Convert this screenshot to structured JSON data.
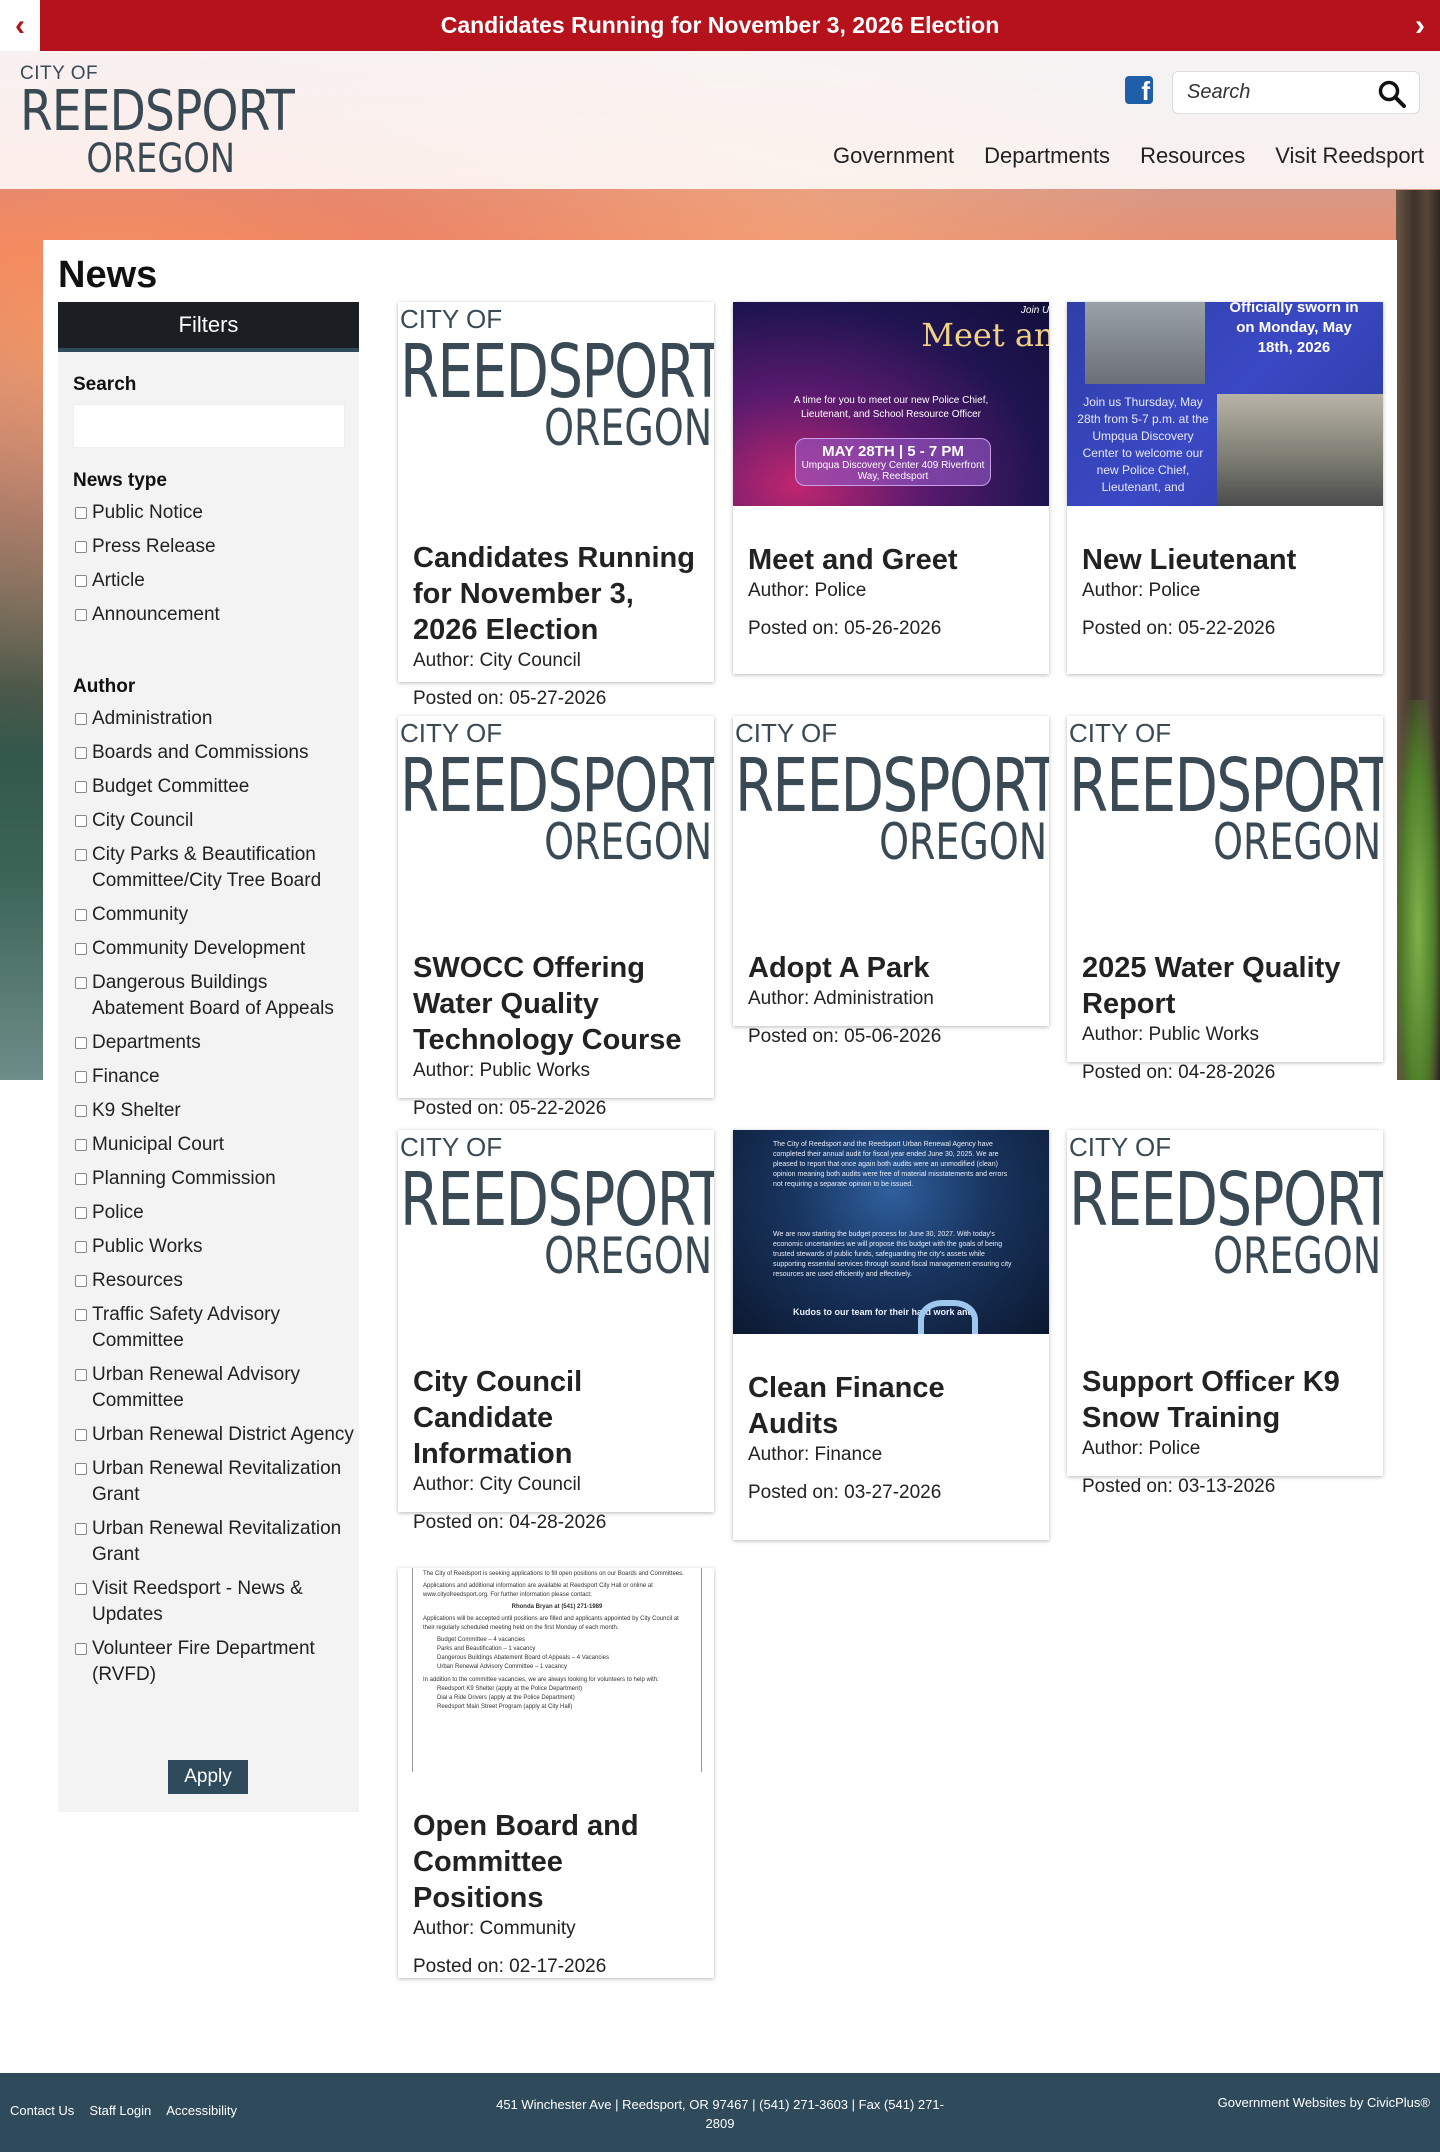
{
  "alert": {
    "text": "Candidates Running for November 3, 2026 Election",
    "prev_icon": "chevron-left-icon",
    "next_icon": "chevron-right-icon"
  },
  "header": {
    "logo": {
      "city_of": "CITY OF",
      "main": "REEDSPORT",
      "sub": "OREGON"
    },
    "facebook_icon": "facebook-icon",
    "search_placeholder": "Search",
    "nav": [
      "Government",
      "Departments",
      "Resources",
      "Visit Reedsport"
    ]
  },
  "page": {
    "title": "News"
  },
  "filters": {
    "header": "Filters",
    "search_label": "Search",
    "search_value": "",
    "news_type_label": "News type",
    "news_types": [
      "Public Notice",
      "Press Release",
      "Article",
      "Announcement"
    ],
    "author_label": "Author",
    "authors": [
      "Administration",
      "Boards and Commissions",
      "Budget Committee",
      "City Council",
      "City Parks & Beautification Committee/City Tree Board",
      "Community",
      "Community Development",
      "Dangerous Buildings Abatement Board of Appeals",
      "Departments",
      "Finance",
      "K9 Shelter",
      "Municipal Court",
      "Planning Commission",
      "Police",
      "Public Works",
      "Resources",
      "Traffic Safety Advisory Committee",
      "Urban Renewal Advisory Committee",
      "Urban Renewal District Agency",
      "Urban Renewal Revitalization Grant",
      "Urban Renewal Revitalization Grant",
      "Visit Reedsport - News & Updates",
      "Volunteer Fire Department (RVFD)"
    ],
    "apply_label": "Apply"
  },
  "cards": [
    {
      "title": "Candidates Running for November 3, 2026 Election",
      "author": "Author: City Council",
      "posted": "Posted on: 05-27-2026"
    },
    {
      "title": "Meet and Greet",
      "author": "Author: Police",
      "posted": "Posted on: 05-26-2026"
    },
    {
      "title": "New Lieutenant",
      "author": "Author: Police",
      "posted": "Posted on: 05-22-2026"
    },
    {
      "title": "SWOCC Offering Water Quality Technology Course",
      "author": "Author: Public Works",
      "posted": "Posted on: 05-22-2026"
    },
    {
      "title": "Adopt A Park",
      "author": "Author: Administration",
      "posted": "Posted on: 05-06-2026"
    },
    {
      "title": "2025 Water Quality Report",
      "author": "Author: Public Works",
      "posted": "Posted on: 04-28-2026"
    },
    {
      "title": "City Council Candidate Information",
      "author": "Author: City Council",
      "posted": "Posted on: 04-28-2026"
    },
    {
      "title": "Clean Finance Audits",
      "author": "Author: Finance",
      "posted": "Posted on: 03-27-2026"
    },
    {
      "title": "Support Officer K9 Snow Training",
      "author": "Author: Police",
      "posted": "Posted on: 03-13-2026"
    },
    {
      "title": "Open Board and Committee Positions",
      "author": "Author: Community",
      "posted": "Posted on: 02-17-2026"
    }
  ],
  "thumbs": {
    "logo": {
      "city_of": "CITY OF",
      "main": "REEDSPORT",
      "sub": "OREGON"
    },
    "meet": {
      "small": "Join Us for a",
      "big": "Meet and Greet",
      "mid": "A time for you to meet our new Police Chief, Lieutenant, and School Resource Officer",
      "pill": "MAY 28TH | 5 - 7 PM",
      "pill_sub": "Umpqua Discovery Center 409 Riverfront Way, Reedsport"
    },
    "lieut": {
      "top": "Officially sworn in on Monday, May 18th, 2026",
      "text": "Join us Thursday, May 28th from 5-7 p.m. at the Umpqua Discovery Center to welcome our new Police Chief, Lieutenant, and"
    },
    "finance": {
      "text1": "The City of Reedsport and the Reedsport Urban Renewal Agency have completed their annual audit for fiscal year ended June 30, 2025. We are pleased to report that once again both audits were an unmodified (clean) opinion meaning both audits were free of material misstatements and errors not requiring a separate opinion to be issued.",
      "text2": "We are now starting the budget process for June 30, 2027. With today's economic uncertainties we will propose this budget with the goals of being trusted stewards of public funds, safeguarding the city's assets while supporting essential services through sound fiscal management ensuring city resources are used efficiently and effectively.",
      "bottom": "Kudos to our team for their hard work and"
    },
    "doc": {
      "p1": "The City of Reedsport is seeking applications to fill open positions on our Boards and Committees.",
      "p2": "Applications and additional information are available at Reedsport City Hall or online at www.cityofreedsport.org. For further information please contact:",
      "contact": "Rhonda Bryan at (541) 271-1989",
      "p3": "Applications will be accepted until positions are filled and applicants appointed by City Council at their regularly scheduled meeting held on the first Monday of each month.",
      "list": [
        "Budget Committee – 4 vacancies",
        "Parks and Beautification – 1 vacancy",
        "Dangerous Buildings Abatement Board of Appeals – 4 Vacancies",
        "Urban Renewal Advisory Committee – 1 vacancy"
      ],
      "p4": "In addition to the committee vacancies, we are always looking for volunteers to help with:",
      "list2": [
        "Reedsport K9 Shelter (apply at the Police Department)",
        "Dial a Ride Drivers (apply at the Police Department)",
        "Reedsport Main Street Program (apply at City Hall)"
      ]
    }
  },
  "footer": {
    "links": [
      "Contact Us",
      "Staff Login",
      "Accessibility"
    ],
    "address": "451 Winchester Ave | Reedsport, OR 97467 | (541) 271-3603 | Fax (541) 271-2809",
    "credit": "Government Websites by CivicPlus®"
  },
  "colors": {
    "alert": "#b5121b",
    "dark": "#1b1f23",
    "accent": "#2f4a5a"
  }
}
